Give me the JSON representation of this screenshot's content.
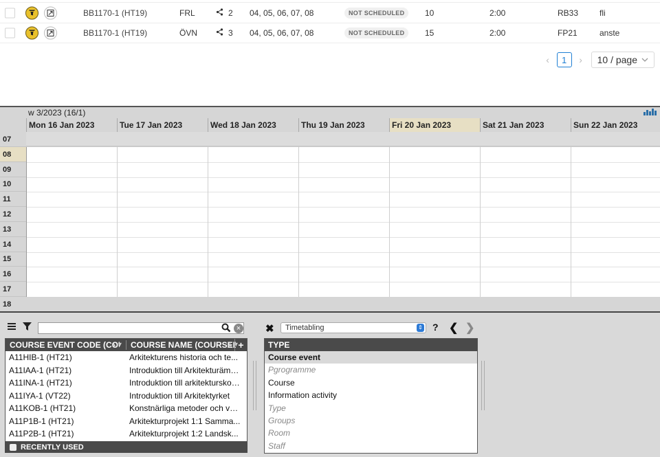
{
  "top_table": {
    "rows": [
      {
        "code": "BB1170-1 (HT19)",
        "type": "FRL",
        "shares": "2",
        "weeks": "04, 05, 06, 07, 08",
        "status": "NOT SCHEDULED",
        "count": "10",
        "duration": "2:00",
        "room": "RB33",
        "note": "fli"
      },
      {
        "code": "BB1170-1 (HT19)",
        "type": "ÖVN",
        "shares": "3",
        "weeks": "04, 05, 06, 07, 08",
        "status": "NOT SCHEDULED",
        "count": "15",
        "duration": "2:00",
        "room": "FP21",
        "note": "anste"
      }
    ]
  },
  "pagination": {
    "current_page": "1",
    "page_size": "10 / page",
    "prev_icon": "chevron-left-icon",
    "next_icon": "chevron-right-icon"
  },
  "calendar": {
    "week_label": "w 3/2023 (16/1)",
    "days": [
      "Mon 16 Jan 2023",
      "Tue 17 Jan 2023",
      "Wed 18 Jan 2023",
      "Thu 19 Jan 2023",
      "Fri 20 Jan 2023",
      "Sat 21 Jan 2023",
      "Sun 22 Jan 2023"
    ],
    "today_index": 4,
    "hours": [
      "07",
      "08",
      "09",
      "10",
      "11",
      "12",
      "13",
      "14",
      "15",
      "16",
      "17",
      "18"
    ],
    "highlight_hour": "08",
    "chart_icon_color": "#2b6fa8"
  },
  "left_panel": {
    "search_placeholder": "",
    "columns": [
      "COURSE EVENT CODE (COURS...",
      "COURSE NAME (COURSEEVT...",
      "+"
    ],
    "rows": [
      {
        "code": "A11HIB-1 (HT21)",
        "name": "Arkitekturens historia och te..."
      },
      {
        "code": "A11IAA-1 (HT21)",
        "name": "Introduktion till Arkitekturämnet"
      },
      {
        "code": "A11INA-1 (HT21)",
        "name": "Introduktion till arkitekturskolan"
      },
      {
        "code": "A11IYA-1 (VT22)",
        "name": "Introduktion till Arkitektyrket"
      },
      {
        "code": "A11KOB-1 (HT21)",
        "name": "Konstnärliga metoder och ve..."
      },
      {
        "code": "A11P1B-1 (HT21)",
        "name": "Arkitekturprojekt 1:1 Samma..."
      },
      {
        "code": "A11P2B-1 (HT21)",
        "name": "Arkitekturprojekt 1:2 Landsk..."
      }
    ],
    "recently_used": "RECENTLY USED"
  },
  "right_panel": {
    "select_value": "Timetabling",
    "help": "?",
    "header": "TYPE",
    "types": [
      {
        "label": "Course event",
        "style": "selected"
      },
      {
        "label": "Pgrogramme",
        "style": "italic"
      },
      {
        "label": "Course",
        "style": "normal"
      },
      {
        "label": "Information activity",
        "style": "normal"
      },
      {
        "label": "Type",
        "style": "italic"
      },
      {
        "label": "Groups",
        "style": "italic"
      },
      {
        "label": "Room",
        "style": "italic"
      },
      {
        "label": "Staff",
        "style": "italic"
      }
    ]
  }
}
